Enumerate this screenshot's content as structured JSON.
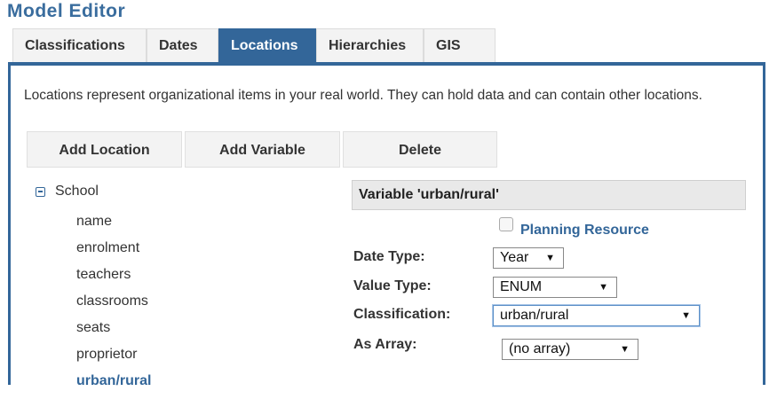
{
  "app": {
    "title": "Model Editor"
  },
  "tabs": [
    {
      "label": "Classifications",
      "active": false
    },
    {
      "label": "Dates",
      "active": false
    },
    {
      "label": "Locations",
      "active": true
    },
    {
      "label": "Hierarchies",
      "active": false
    },
    {
      "label": "GIS",
      "active": false
    }
  ],
  "colors": {
    "accent": "#336699",
    "title": "#3a6d9e"
  },
  "description": "Locations represent organizational items in your real world. They can hold data and can contain other locations.",
  "toolbar": {
    "add_location": "Add Location",
    "add_variable": "Add Variable",
    "delete": "Delete"
  },
  "tree": {
    "root": {
      "label": "School",
      "expanded": true,
      "icon": "collapse-minus-icon"
    },
    "children": [
      "name",
      "enrolment",
      "teachers",
      "classrooms",
      "seats",
      "proprietor",
      "urban/rural"
    ],
    "selected": "urban/rural"
  },
  "variable": {
    "header": "Variable 'urban/rural'",
    "planning_resource": {
      "label": "Planning Resource",
      "checked": false
    },
    "date_type": {
      "label": "Date Type:",
      "value": "Year"
    },
    "value_type": {
      "label": "Value Type:",
      "value": "ENUM"
    },
    "classification": {
      "label": "Classification:",
      "value": "urban/rural"
    },
    "as_array": {
      "label": "As Array:",
      "value": "(no array)"
    }
  }
}
